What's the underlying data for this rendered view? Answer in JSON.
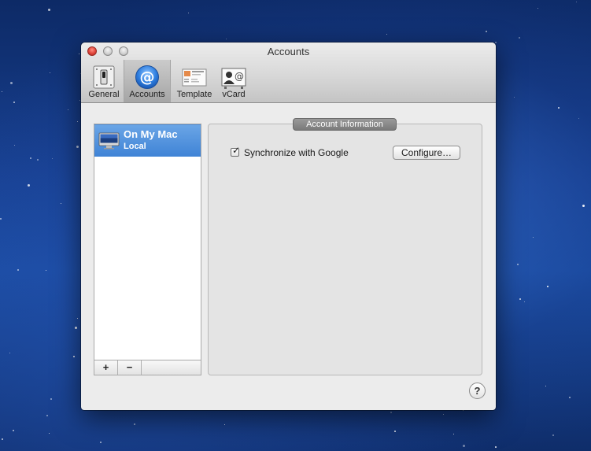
{
  "window": {
    "title": "Accounts"
  },
  "toolbar": {
    "items": [
      {
        "label": "General",
        "icon": "switch-icon",
        "selected": false
      },
      {
        "label": "Accounts",
        "icon": "at-sign-icon",
        "selected": true
      },
      {
        "label": "Template",
        "icon": "template-icon",
        "selected": false
      },
      {
        "label": "vCard",
        "icon": "vcard-icon",
        "selected": false
      }
    ]
  },
  "accounts_list": {
    "items": [
      {
        "name": "On My Mac",
        "type": "Local",
        "icon": "imac-icon",
        "selected": true
      }
    ],
    "add_label": "+",
    "remove_label": "−"
  },
  "account_info": {
    "group_label": "Account Information",
    "sync_checkbox": {
      "label": "Synchronize with Google",
      "checked": true
    },
    "configure_label": "Configure…"
  },
  "help_label": "?",
  "colors": {
    "selection": "#3f83d6",
    "close_button": "#e0443a",
    "desktop": "#173f8f"
  }
}
